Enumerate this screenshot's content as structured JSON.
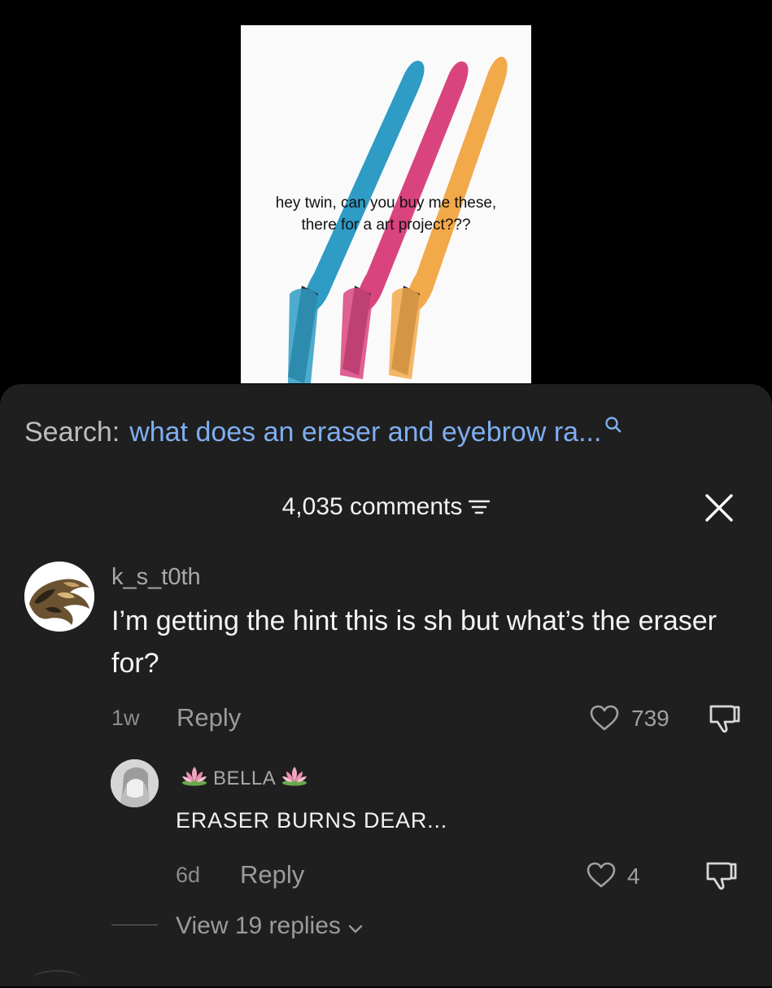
{
  "video": {
    "caption_line1": "hey twin, can you buy me these,",
    "caption_line2": "there for a art project???"
  },
  "search": {
    "prefix": "Search:",
    "query": "what does an eraser and eyebrow ra..."
  },
  "comments_header": {
    "count_label": "4,035 comments"
  },
  "comment": {
    "username": "k_s_t0th",
    "text": "I’m getting the hint this is sh but what’s the eraser for?",
    "time": "1w",
    "reply_label": "Reply",
    "likes": "739"
  },
  "reply": {
    "username": "BELLA",
    "text": "ERASER BURNS DEAR...",
    "time": "6d",
    "reply_label": "Reply",
    "likes": "4"
  },
  "view_replies": {
    "label": "View 19 replies"
  },
  "colors": {
    "sheet_bg": "#1f1f1f",
    "search_query": "#7eaef0",
    "razor_blue": "#2e9cc4",
    "razor_pink": "#d9447f",
    "razor_orange": "#f2a94a"
  }
}
